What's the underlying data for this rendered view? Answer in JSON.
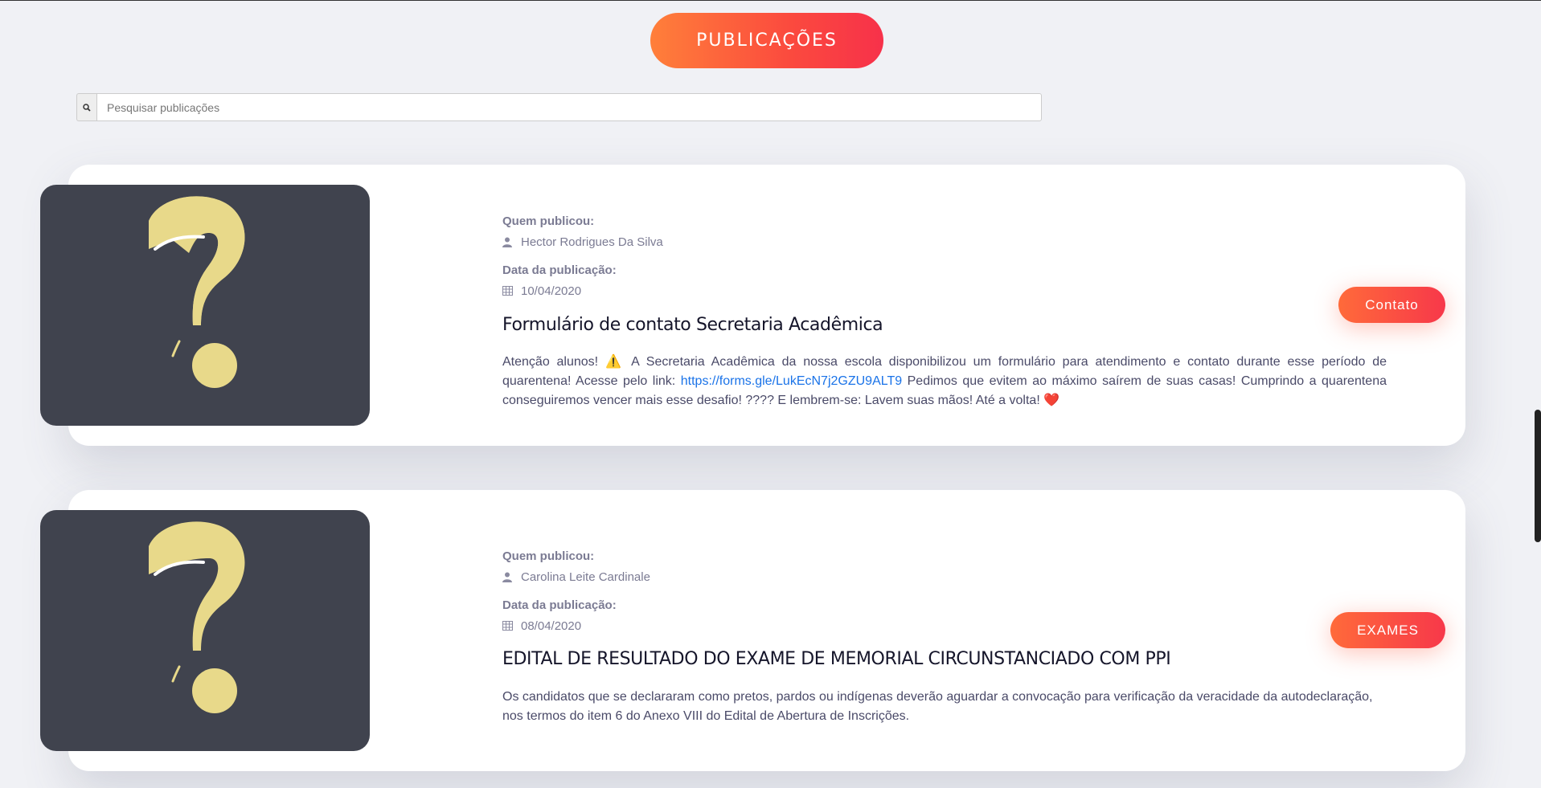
{
  "header": {
    "title": "PUBLICAÇÕES"
  },
  "search": {
    "placeholder": "Pesquisar publicações",
    "icon": "search-icon"
  },
  "labels": {
    "author": "Quem publicou:",
    "date": "Data da publicação:"
  },
  "posts": [
    {
      "author": "Hector Rodrigues Da Silva",
      "date": "10/04/2020",
      "title": "Formulário de contato Secretaria Acadêmica",
      "body_pre": "Atenção alunos! ⚠️ A Secretaria Acadêmica da nossa escola disponibilizou um formulário para atendimento e contato durante esse período de quarentena! Acesse pelo link: ",
      "link": "https://forms.gle/LukEcN7j2GZU9ALT9",
      "body_post": " Pedimos que evitem ao máximo saírem de suas casas! Cumprindo a quarentena conseguiremos vencer mais esse desafio! ???? E lembrem-se: Lavem suas mãos! Até a volta! ❤️",
      "button": "Contato"
    },
    {
      "author": "Carolina Leite Cardinale",
      "date": "08/04/2020",
      "title": "EDITAL DE RESULTADO DO EXAME DE MEMORIAL CIRCUNSTANCIADO COM PPI",
      "body_pre": "Os candidatos que se declararam como pretos, pardos ou indígenas deverão aguardar a convocação para verificação da veracidade da autodeclaração, nos termos do item 6 do Anexo VIII do Edital de Abertura de Inscrições.",
      "link": "",
      "body_post": "",
      "button": "EXAMES"
    }
  ],
  "colors": {
    "accent_start": "#ff7f3a",
    "accent_end": "#f7314a",
    "thumb_bg": "#40434e",
    "question_mark": "#e8d98a",
    "link": "#1a73e8"
  }
}
